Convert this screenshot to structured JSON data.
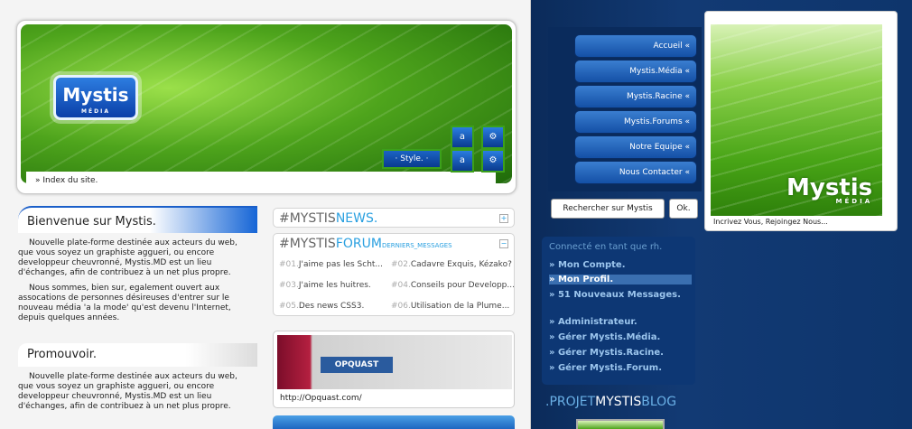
{
  "header": {
    "breadcrumb": "» Index du site.",
    "style_button": "· Style. ·",
    "logo_text": "Mystis",
    "logo_sub": "MÉDIA"
  },
  "welcome": {
    "title": "Bienvenue sur Mystis.",
    "p1": "Nouvelle plate-forme destinée aux acteurs du web, que vous soyez un graphiste aggueri, ou encore developpeur cheuvronné, Mystis.MD est un lieu d'échanges, afin de contribuez à un net plus propre.",
    "p2": "Nous sommes, bien sur, egalement ouvert aux assocations de personnes désireuses d'entrer sur le nouveau média 'a la mode' qu'est devenu l'Internet, depuis quelques années."
  },
  "promo": {
    "title": "Promouvoir.",
    "p1": "Nouvelle plate-forme destinée aux acteurs du web, que vous soyez un graphiste aggueri, ou encore developpeur cheuvronné, Mystis.MD est un lieu d'échanges, afin de contribuez à un net plus propre."
  },
  "news": {
    "prefix": "#MYSTIS",
    "word": "NEWS."
  },
  "forum": {
    "prefix": "#MYSTIS",
    "word": "FORUM",
    "sub": "DERNIERS_MESSAGES",
    "items": [
      {
        "n": "#01.",
        "t": "J'aime pas les Scht..."
      },
      {
        "n": "#02.",
        "t": "Cadavre Exquis, Kézako?"
      },
      {
        "n": "#03.",
        "t": "J'aime les huitres."
      },
      {
        "n": "#04.",
        "t": "Conseils pour Developp..."
      },
      {
        "n": "#05.",
        "t": "Des news CSS3."
      },
      {
        "n": "#06.",
        "t": "Utilisation de la Plume..."
      }
    ]
  },
  "showcase": {
    "url": "http://Opquast.com/",
    "brand": "OPQUAST"
  },
  "nav": {
    "items": [
      "Accueil «",
      "Mystis.Média «",
      "Mystis.Racine «",
      "Mystis.Forums «",
      "Notre Equipe «",
      "Nous Contacter «"
    ]
  },
  "search": {
    "label": "Rechercher sur Mystis",
    "ok": "Ok."
  },
  "photo": {
    "caption": "Incrivez Vous, Rejoingez Nous...",
    "logo_text": "Mystis",
    "logo_sub": "MÉDIA"
  },
  "account": {
    "header": "Connecté en tant que rh.",
    "items": [
      "» Mon Compte.",
      "» Mon Profil.",
      "» 51 Nouveaux Messages."
    ],
    "admin": [
      "» Administrateur.",
      "» Gérer Mystis.Média.",
      "» Gérer Mystis.Racine.",
      "» Gérer Mystis.Forum."
    ]
  },
  "blog": {
    "a": ".PROJET",
    "b": "MYSTIS",
    "c": "BLOG"
  },
  "icons": [
    "font-size-icon",
    "settings-icon",
    "font-size-small-icon",
    "settings-alt-icon"
  ]
}
